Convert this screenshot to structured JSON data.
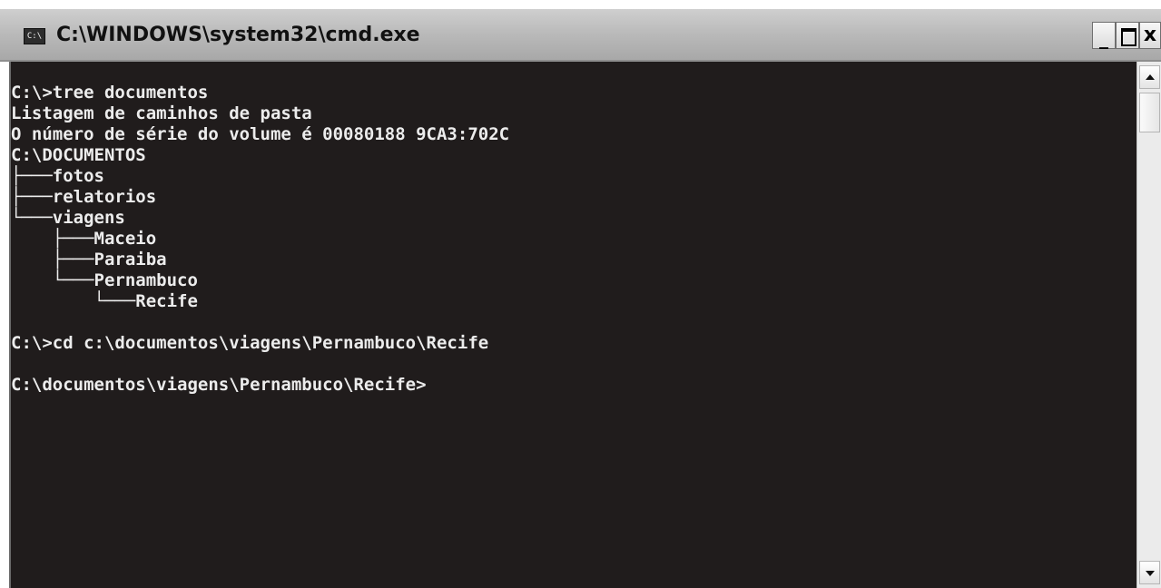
{
  "window": {
    "title": "C:\\WINDOWS\\system32\\cmd.exe",
    "icon": "console-icon",
    "icon_label": "C:\\",
    "minimize_label": "_",
    "close_label": "x"
  },
  "console": {
    "text": "C:\\>tree documentos\nListagem de caminhos de pasta\nO número de série do volume é 00080188 9CA3:702C\nC:\\DOCUMENTOS\n├───fotos\n├───relatorios\n└───viagens\n    ├───Maceio\n    ├───Paraiba\n    └───Pernambuco\n        └───Recife\n\nC:\\>cd c:\\documentos\\viagens\\Pernambuco\\Recife\n\nC:\\documentos\\viagens\\Pernambuco\\Recife>"
  },
  "colors": {
    "console_background": "#201c1c",
    "console_text": "#ececec",
    "titlebar": "#b9b9b9"
  },
  "scrollbar": {
    "up_icon": "arrow-up-icon",
    "down_icon": "arrow-down-icon"
  }
}
